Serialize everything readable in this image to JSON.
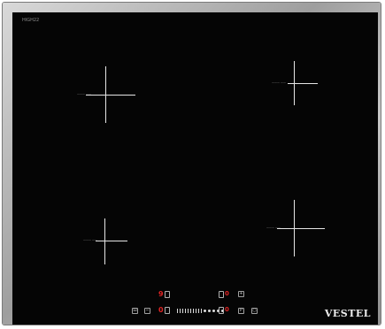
{
  "cooktop": {
    "model": "HIGH22",
    "brand": "VESTEL",
    "zones": [
      {
        "name": "rear-left",
        "label": "——— ——"
      },
      {
        "name": "rear-right",
        "label": "——— ——"
      },
      {
        "name": "front-left",
        "label": "——— ——"
      },
      {
        "name": "front-right",
        "label": "——— ——"
      }
    ],
    "controls": {
      "top_left_display": "9",
      "bottom_left_display": "0",
      "plus_glyph": "+",
      "minus_glyph": "−",
      "lock_glyph": "⊟",
      "power_glyph": "○",
      "timer_glyph": "P"
    }
  }
}
